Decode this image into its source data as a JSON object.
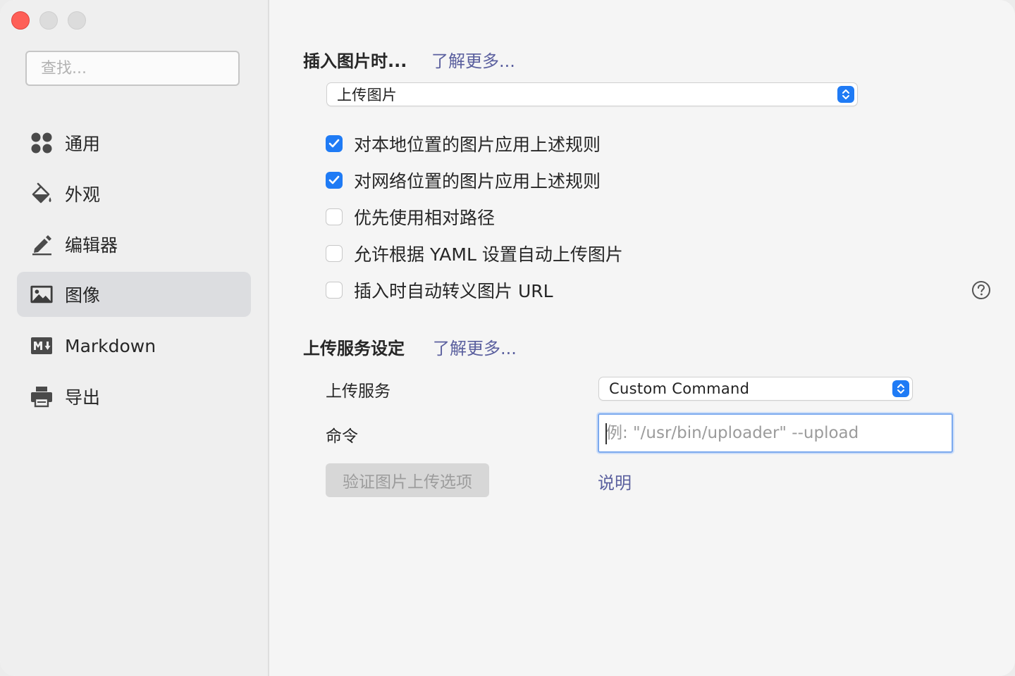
{
  "window": {
    "controls": [
      "close",
      "minimize",
      "maximize"
    ]
  },
  "sidebar": {
    "search_placeholder": "查找...",
    "items": [
      {
        "label": "通用",
        "icon": "grid-icon"
      },
      {
        "label": "外观",
        "icon": "paint-bucket-icon"
      },
      {
        "label": "编辑器",
        "icon": "pencil-icon"
      },
      {
        "label": "图像",
        "icon": "image-icon",
        "active": true
      },
      {
        "label": "Markdown",
        "icon": "markdown-icon"
      },
      {
        "label": "导出",
        "icon": "printer-icon"
      }
    ]
  },
  "insert_image": {
    "title": "插入图片时...",
    "learn_more": "了解更多...",
    "action_select": "上传图片",
    "options": [
      {
        "label": "对本地位置的图片应用上述规则",
        "checked": true
      },
      {
        "label": "对网络位置的图片应用上述规则",
        "checked": true
      },
      {
        "label": "优先使用相对路径",
        "checked": false
      },
      {
        "label": "允许根据 YAML 设置自动上传图片",
        "checked": false
      },
      {
        "label": "插入时自动转义图片 URL",
        "checked": false
      }
    ]
  },
  "upload": {
    "title": "上传服务设定",
    "learn_more": "了解更多...",
    "service_label": "上传服务",
    "service_value": "Custom Command",
    "command_label": "命令",
    "command_placeholder": "例: \"/usr/bin/uploader\" --upload",
    "verify_button": "验证图片上传选项",
    "help_link": "说明"
  },
  "colors": {
    "accent": "#1f7bf5",
    "link": "#5a5f9e",
    "active_item_bg": "#dcdde0",
    "close_button": "#fe5f57"
  }
}
